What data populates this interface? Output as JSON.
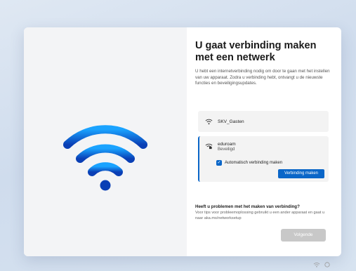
{
  "page": {
    "title": "U gaat verbinding maken met een netwerk",
    "description": "U hebt een internetverbinding nodig om door te gaan met het instellen van uw apparaat. Zodra u verbinding hebt, ontvangt u de nieuwste functies en beveiligingsupdates."
  },
  "networks": [
    {
      "name": "SKV_Gasten",
      "icon": "wifi-icon"
    },
    {
      "name": "eduroam",
      "status": "Beveiligd",
      "icon": "wifi-secured-icon",
      "auto_connect_label": "Automatisch verbinding maken",
      "auto_connect_checked": true,
      "connect_label": "Verbinding maken"
    }
  ],
  "help": {
    "title": "Heeft u problemen met het maken van verbinding?",
    "text": "Voor tips voor probleemoplossing gebruikt u een ander apparaat en gaat u naar aka.ms/networksetup"
  },
  "footer": {
    "next_label": "Volgende"
  },
  "colors": {
    "accent": "#0a66c8",
    "disabled": "#c8c8c8"
  }
}
